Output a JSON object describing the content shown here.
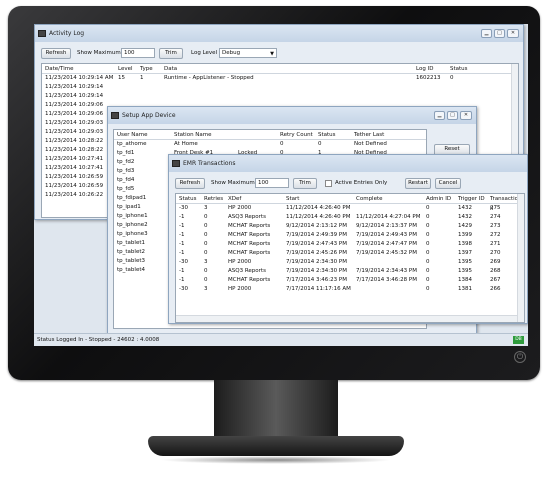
{
  "activity_log": {
    "title": "Activity Log",
    "refresh_label": "Refresh",
    "show_max_label": "Show Maximum",
    "show_max_value": "100",
    "trim_label": "Trim",
    "log_level_label": "Log Level",
    "log_level_value": "Debug",
    "columns": [
      "Date/Time",
      "Level",
      "Type",
      "Data",
      "Log ID",
      "Status"
    ],
    "rows": [
      [
        "11/23/2014 10:29:14 AM",
        "15",
        "1",
        "Runtime - AppListener - Stopped",
        "1602213",
        "0"
      ],
      [
        "11/23/2014 10:29:14"
      ],
      [
        "11/23/2014 10:29:14"
      ],
      [
        "11/23/2014 10:29:06"
      ],
      [
        "11/23/2014 10:29:06"
      ],
      [
        "11/23/2014 10:29:03"
      ],
      [
        "11/23/2014 10:29:03"
      ],
      [
        "11/23/2014 10:28:22"
      ],
      [
        "11/23/2014 10:28:22"
      ],
      [
        "11/23/2014 10:27:41"
      ],
      [
        "11/23/2014 10:27:41"
      ],
      [
        "11/23/2014 10:26:59"
      ],
      [
        "11/23/2014 10:26:59"
      ],
      [
        "11/23/2014 10:26:22"
      ]
    ]
  },
  "setup_device": {
    "title": "Setup App Device",
    "columns": [
      "User Name",
      "Station Name",
      "Retry Count",
      "Status",
      "Tether Last"
    ],
    "rows": [
      [
        "tp_athome",
        "At Home",
        "",
        "0",
        "0",
        "Not Defined"
      ],
      [
        "tp_fd1",
        "Front Desk #1",
        "Locked",
        "0",
        "1",
        "Not Defined"
      ],
      [
        "tp_fd2"
      ],
      [
        "tp_fd3"
      ],
      [
        "tp_fd4"
      ],
      [
        "tp_fd5"
      ],
      [
        "tp_fdipad1"
      ],
      [
        "tp_ipad1"
      ],
      [
        "tp_iphone1"
      ],
      [
        "tp_iphone2"
      ],
      [
        "tp_iphone3"
      ],
      [
        "tp_tablet1"
      ],
      [
        "tp_tablet2"
      ],
      [
        "tp_tablet3"
      ],
      [
        "tp_tablet4"
      ]
    ],
    "reset_label": "Reset"
  },
  "emr": {
    "title": "EMR Transactions",
    "refresh_label": "Refresh",
    "show_max_label": "Show Maximum",
    "show_max_value": "100",
    "trim_label": "Trim",
    "active_only_label": "Active Entries Only",
    "restart_label": "Restart",
    "cancel_label": "Cancel",
    "columns": [
      "Status",
      "Retries",
      "XDef",
      "Start",
      "Complete",
      "Admin ID",
      "Trigger ID",
      "Transaction II"
    ],
    "rows": [
      [
        "-30",
        "3",
        "HP 2000",
        "11/12/2014 4:26:40 PM",
        "",
        "0",
        "1432",
        "275"
      ],
      [
        "-1",
        "0",
        "ASQ3 Reports",
        "11/12/2014 4:26:40 PM",
        "11/12/2014 4:27:04 PM",
        "0",
        "1432",
        "274"
      ],
      [
        "-1",
        "0",
        "MCHAT Reports",
        "9/12/2014 2:13:12 PM",
        "9/12/2014 2:13:37 PM",
        "0",
        "1429",
        "273"
      ],
      [
        "-1",
        "0",
        "MCHAT Reports",
        "7/19/2014 2:49:39 PM",
        "7/19/2014 2:49:43 PM",
        "0",
        "1399",
        "272"
      ],
      [
        "-1",
        "0",
        "MCHAT Reports",
        "7/19/2014 2:47:43 PM",
        "7/19/2014 2:47:47 PM",
        "0",
        "1398",
        "271"
      ],
      [
        "-1",
        "0",
        "MCHAT Reports",
        "7/19/2014 2:45:26 PM",
        "7/19/2014 2:45:32 PM",
        "0",
        "1397",
        "270"
      ],
      [
        "-30",
        "3",
        "HP 2000",
        "7/19/2014 2:34:30 PM",
        "",
        "0",
        "1395",
        "269"
      ],
      [
        "-1",
        "0",
        "ASQ3 Reports",
        "7/19/2014 2:34:30 PM",
        "7/19/2014 2:34:43 PM",
        "0",
        "1395",
        "268"
      ],
      [
        "-1",
        "0",
        "MCHAT Reports",
        "7/17/2014 3:46:23 PM",
        "7/17/2014 3:46:28 PM",
        "0",
        "1384",
        "267"
      ],
      [
        "-30",
        "3",
        "HP 2000",
        "7/17/2014 11:17:16 AM",
        "",
        "0",
        "1381",
        "266"
      ]
    ]
  },
  "status_bar": {
    "text": "Status  Logged In - Stopped - 24602 : 4.0008",
    "db_label": "DB"
  },
  "power_glyph": "⏻",
  "colors": {
    "db_badge": "#2e9b3c",
    "title_bar": "#c5d5e7"
  }
}
